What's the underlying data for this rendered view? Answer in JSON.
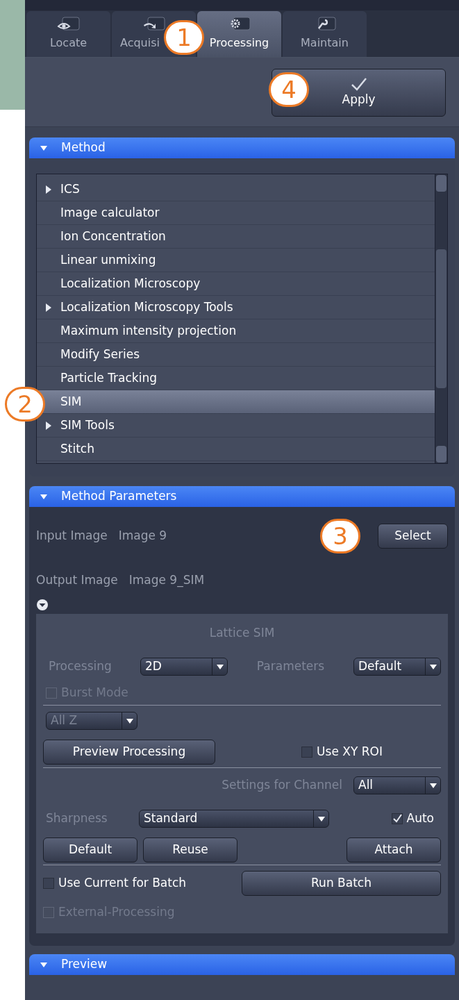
{
  "tabs": [
    {
      "label": "Locate",
      "selected": false
    },
    {
      "label": "Acquisi",
      "selected": false
    },
    {
      "label": "Processing",
      "selected": true
    },
    {
      "label": "Maintain",
      "selected": false
    }
  ],
  "apply_button": {
    "label": "Apply"
  },
  "method": {
    "title": "Method",
    "items": [
      {
        "label": "ICS",
        "expandable": true,
        "selected": false
      },
      {
        "label": "Image calculator",
        "expandable": false,
        "selected": false
      },
      {
        "label": "Ion Concentration",
        "expandable": false,
        "selected": false
      },
      {
        "label": "Linear unmixing",
        "expandable": false,
        "selected": false
      },
      {
        "label": "Localization Microscopy",
        "expandable": false,
        "selected": false
      },
      {
        "label": "Localization Microscopy Tools",
        "expandable": true,
        "selected": false
      },
      {
        "label": "Maximum intensity projection",
        "expandable": false,
        "selected": false
      },
      {
        "label": "Modify Series",
        "expandable": false,
        "selected": false
      },
      {
        "label": "Particle Tracking",
        "expandable": false,
        "selected": false
      },
      {
        "label": "SIM",
        "expandable": false,
        "selected": true
      },
      {
        "label": "SIM Tools",
        "expandable": true,
        "selected": false
      },
      {
        "label": "Stitch",
        "expandable": false,
        "selected": false
      }
    ]
  },
  "method_parameters": {
    "title": "Method Parameters",
    "input_image": {
      "label": "Input Image",
      "value": "Image 9"
    },
    "select_button": "Select",
    "output_image": {
      "label": "Output Image",
      "value": "Image 9_SIM"
    },
    "lattice_sim": {
      "title": "Lattice SIM",
      "processing": {
        "label": "Processing",
        "value": "2D"
      },
      "parameters": {
        "label": "Parameters",
        "value": "Default"
      },
      "burst_mode": {
        "label": "Burst Mode",
        "checked": false,
        "disabled": true
      },
      "z_mode": {
        "value": "All Z",
        "disabled": true
      },
      "preview_button": "Preview Processing",
      "use_xy_roi": {
        "label": "Use XY ROI",
        "checked": false,
        "disabled": false
      },
      "settings_for_channel": {
        "label": "Settings for Channel",
        "value": "All"
      },
      "sharpness": {
        "label": "Sharpness",
        "value": "Standard"
      },
      "auto": {
        "label": "Auto",
        "checked": true,
        "disabled": false
      },
      "buttons": [
        "Default",
        "Reuse",
        "Attach"
      ],
      "use_current_for_batch": {
        "label": "Use Current for Batch",
        "checked": false,
        "disabled": false
      },
      "run_batch_button": "Run Batch",
      "external_processing": {
        "label": "External-Processing",
        "checked": false,
        "disabled": true
      }
    }
  },
  "preview": {
    "title": "Preview"
  },
  "callouts": [
    "1",
    "2",
    "3",
    "4"
  ]
}
